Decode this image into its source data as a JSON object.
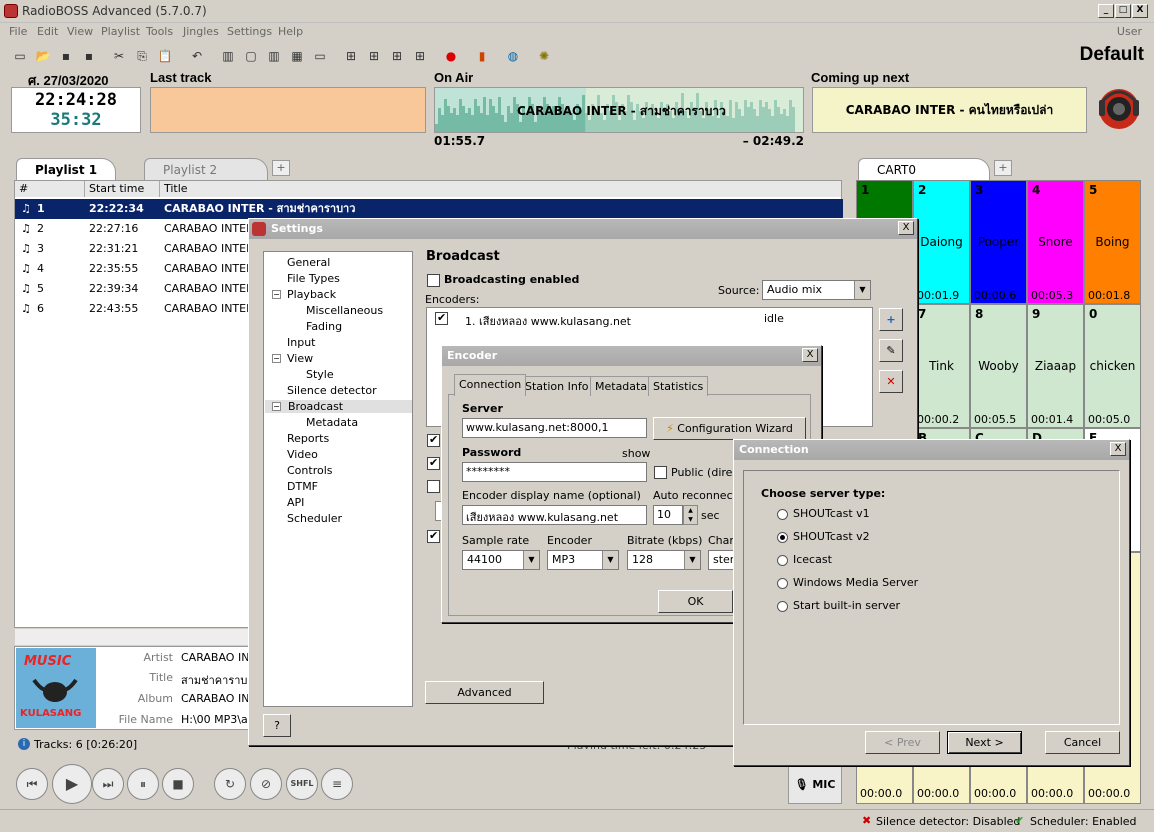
{
  "app": {
    "title": "RadioBOSS Advanced (5.7.0.7)",
    "profile": "Default",
    "user": "User"
  },
  "menu": [
    "File",
    "Edit",
    "View",
    "Playlist",
    "Tools",
    "Jingles",
    "Settings",
    "Help"
  ],
  "info": {
    "date": "ศ. 27/03/2020",
    "last_track_label": "Last track",
    "on_air_label": "On Air",
    "coming_up_label": "Coming up next",
    "clock": "22:24:28",
    "elapsed": "35:32",
    "on_air_title": "CARABAO INTER - สามช่าคาราบาว",
    "on_air_pos": "01:55.7",
    "on_air_remaining": "– 02:49.2",
    "on_air_progress": 0.41,
    "coming_up_title": "CARABAO INTER - คนไทยหรือเปล่า"
  },
  "playlist": {
    "tabs": [
      "Playlist 1",
      "Playlist 2"
    ],
    "columns": [
      "#",
      "Start time",
      "Title"
    ],
    "rows": [
      {
        "num": "1",
        "time": "22:22:34",
        "title": "CARABAO INTER - สามช่าคาราบาว"
      },
      {
        "num": "2",
        "time": "22:27:16",
        "title": "CARABAO INTER"
      },
      {
        "num": "3",
        "time": "22:31:21",
        "title": "CARABAO INTER"
      },
      {
        "num": "4",
        "time": "22:35:55",
        "title": "CARABAO INTER"
      },
      {
        "num": "5",
        "time": "22:39:34",
        "title": "CARABAO INTER"
      },
      {
        "num": "6",
        "time": "22:43:55",
        "title": "CARABAO INTER"
      }
    ],
    "track_info": {
      "artist_label": "Artist",
      "artist": "CARABAO INT",
      "title_label": "Title",
      "title": "สามช่าคาราบา",
      "album_label": "Album",
      "album": "CARABAO INT",
      "file_label": "File Name",
      "file": "H:\\00 MP3\\ar",
      "cover_text": "MUSIC",
      "cover_brand": "KULASANG"
    },
    "tracks_summary": "Tracks: 6 [0:26:20]",
    "playing_time_left": "Playing time left: 0:24:23",
    "mic_label": "MIC",
    "shfl_label": "SHFL"
  },
  "cart": {
    "tab": "CART0",
    "row1": [
      {
        "n": "1",
        "label": "",
        "dur": "",
        "color": "#007800"
      },
      {
        "n": "2",
        "label": "Daiong",
        "dur": "00:01.9",
        "color": "#00ffff"
      },
      {
        "n": "3",
        "label": "Pooper",
        "dur": "00:00.6",
        "color": "#0000ff"
      },
      {
        "n": "4",
        "label": "Snore",
        "dur": "00:05.3",
        "color": "#ff00ff"
      },
      {
        "n": "5",
        "label": "Boing",
        "dur": "00:01.8",
        "color": "#ff8000"
      }
    ],
    "row2": [
      {
        "n": "6",
        "label": "",
        "dur": ""
      },
      {
        "n": "7",
        "label": "Tink",
        "dur": "00:00.2"
      },
      {
        "n": "8",
        "label": "Wooby",
        "dur": "00:05.5"
      },
      {
        "n": "9",
        "label": "Ziaaap",
        "dur": "00:01.4"
      },
      {
        "n": "0",
        "label": "chicken",
        "dur": "00:05.0"
      }
    ],
    "row3": [
      {
        "n": "A"
      },
      {
        "n": "B"
      },
      {
        "n": "C"
      },
      {
        "n": "D"
      },
      {
        "n": "E"
      }
    ],
    "bottom_durs": [
      "00:00.0",
      "00:00.0",
      "00:00.0",
      "00:00.0",
      "00:00.0"
    ]
  },
  "status": {
    "silence": "Silence detector: Disabled",
    "scheduler": "Scheduler: Enabled"
  },
  "settings": {
    "title": "Settings",
    "tree": [
      "General",
      "File Types",
      "Playback",
      "Miscellaneous",
      "Fading",
      "Input",
      "View",
      "Style",
      "Silence detector",
      "Broadcast",
      "Metadata",
      "Reports",
      "Video",
      "Controls",
      "DTMF",
      "API",
      "Scheduler"
    ],
    "heading": "Broadcast",
    "broadcasting_enabled": "Broadcasting enabled",
    "source_label": "Source:",
    "source_value": "Audio mix",
    "encoders_label": "Encoders:",
    "encoder_row": "1. เสียงหลอง www.kulasang.net",
    "encoder_status": "idle",
    "advanced_button": "Advanced",
    "help_button": "?"
  },
  "encoder": {
    "title": "Encoder",
    "tabs": [
      "Connection",
      "Station Info",
      "Metadata",
      "Statistics"
    ],
    "server_label": "Server",
    "server_value": "www.kulasang.net:8000,1",
    "wizard_button": "Configuration Wizard",
    "password_label": "Password",
    "password_value": "********",
    "show_label": "show",
    "public_label": "Public (directo",
    "display_name_label": "Encoder display name (optional)",
    "display_name_value": "เสียงหลอง www.kulasang.net",
    "auto_reconnect_label": "Auto reconnect",
    "auto_reconnect_value": "10",
    "sec_label": "sec",
    "sample_rate_label": "Sample rate",
    "sample_rate_value": "44100",
    "encoder_label": "Encoder",
    "encoder_value": "MP3",
    "bitrate_label": "Bitrate (kbps)",
    "bitrate_value": "128",
    "channels_label": "Chann",
    "channels_value": "stere",
    "ok_button": "OK"
  },
  "connection": {
    "title": "Connection",
    "prompt": "Choose server type:",
    "options": [
      "SHOUTcast v1",
      "SHOUTcast v2",
      "Icecast",
      "Windows Media Server",
      "Start built-in server"
    ],
    "selected_index": 1,
    "prev_button": "< Prev",
    "next_button": "Next >",
    "cancel_button": "Cancel"
  }
}
